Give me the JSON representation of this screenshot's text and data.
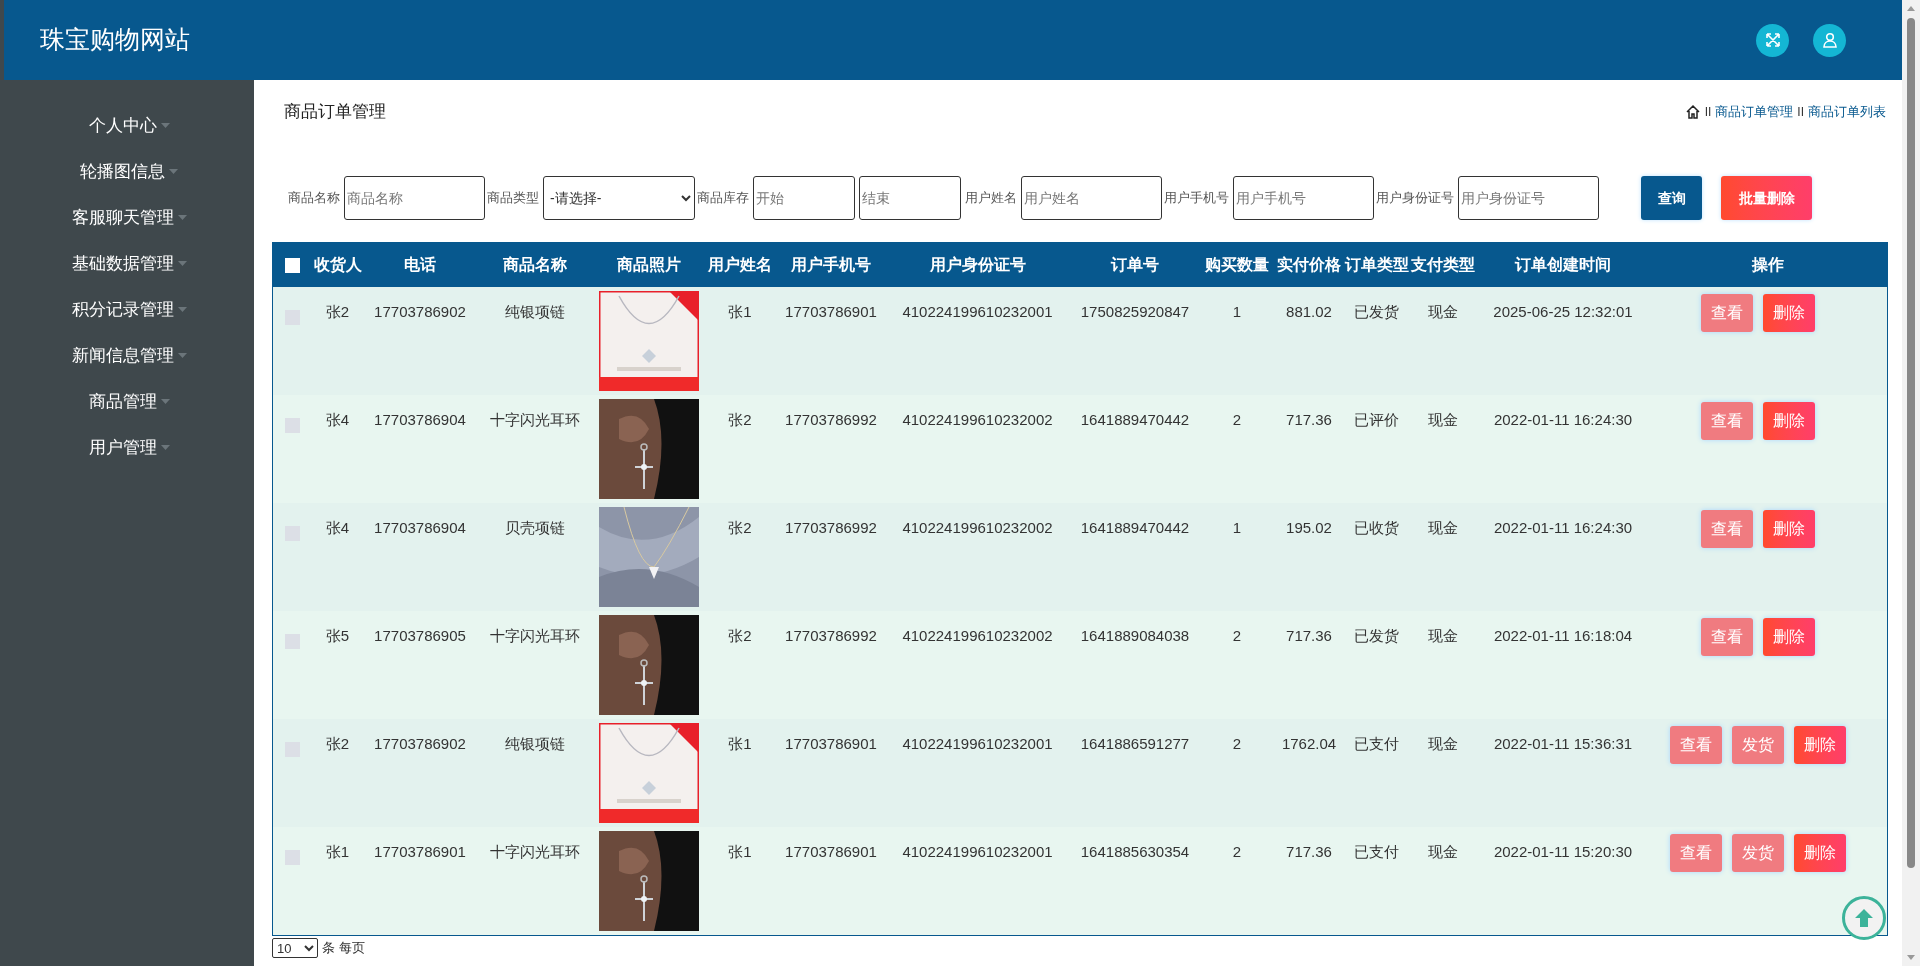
{
  "header": {
    "title": "珠宝购物网站"
  },
  "sidebar": {
    "items": [
      {
        "label": "个人中心"
      },
      {
        "label": "轮播图信息"
      },
      {
        "label": "客服聊天管理"
      },
      {
        "label": "基础数据管理"
      },
      {
        "label": "积分记录管理"
      },
      {
        "label": "新闻信息管理"
      },
      {
        "label": "商品管理"
      },
      {
        "label": "用户管理"
      }
    ]
  },
  "page_title": "商品订单管理",
  "breadcrumb": [
    {
      "kind": "home"
    },
    {
      "kind": "separator",
      "text": "II"
    },
    {
      "kind": "link",
      "text": "商品订单管理"
    },
    {
      "kind": "separator",
      "text": "II"
    },
    {
      "kind": "link",
      "text": "商品订单列表"
    }
  ],
  "search": {
    "fields": [
      {
        "label": "商品名称",
        "inputs": [
          {
            "kind": "text",
            "placeholder": "商品名称"
          }
        ]
      },
      {
        "label": "商品类型",
        "inputs": [
          {
            "kind": "select",
            "value": "-请选择-"
          }
        ]
      },
      {
        "label": "商品库存",
        "inputs": [
          {
            "kind": "short",
            "placeholder": "开始"
          },
          {
            "kind": "short",
            "placeholder": "结束"
          }
        ]
      },
      {
        "label": "用户姓名",
        "inputs": [
          {
            "kind": "text",
            "placeholder": "用户姓名"
          }
        ]
      },
      {
        "label": "用户手机号",
        "inputs": [
          {
            "kind": "text",
            "placeholder": "用户手机号"
          }
        ]
      },
      {
        "label": "用户身份证号",
        "inputs": [
          {
            "kind": "text",
            "placeholder": "用户身份证号"
          }
        ]
      }
    ],
    "buttons": [
      {
        "kind": "query",
        "label": "查询"
      },
      {
        "kind": "bulk_delete",
        "label": "批量删除"
      }
    ]
  },
  "table": {
    "select_all_checked": false,
    "columns": [
      "收货人",
      "电话",
      "商品名称",
      "商品照片",
      "用户姓名",
      "用户手机号",
      "用户身份证号",
      "订单号",
      "购买数量",
      "实付价格",
      "订单类型",
      "支付类型",
      "订单创建时间",
      "操作"
    ],
    "rows": [
      {
        "checked": false,
        "cells": [
          "张2",
          "17703786902",
          "纯银项链",
          {
            "kind": "picture"
          },
          "张1",
          "17703786901",
          "410224199610232001",
          "1750825920847",
          "1",
          "881.02",
          "已发货",
          "现金",
          "2025-06-25 12:32:01"
        ],
        "actions": [
          {
            "kind": "view",
            "label": "查看"
          },
          {
            "kind": "delete",
            "label": "删除"
          }
        ]
      },
      {
        "checked": false,
        "cells": [
          "张4",
          "17703786904",
          "十字闪光耳环",
          {
            "kind": "picture"
          },
          "张2",
          "17703786992",
          "410224199610232002",
          "1641889470442",
          "2",
          "717.36",
          "已评价",
          "现金",
          "2022-01-11 16:24:30"
        ],
        "actions": [
          {
            "kind": "view",
            "label": "查看"
          },
          {
            "kind": "delete",
            "label": "删除"
          }
        ]
      },
      {
        "checked": false,
        "cells": [
          "张4",
          "17703786904",
          "贝壳项链",
          {
            "kind": "picture"
          },
          "张2",
          "17703786992",
          "410224199610232002",
          "1641889470442",
          "1",
          "195.02",
          "已收货",
          "现金",
          "2022-01-11 16:24:30"
        ],
        "actions": [
          {
            "kind": "view",
            "label": "查看"
          },
          {
            "kind": "delete",
            "label": "删除"
          }
        ]
      },
      {
        "checked": false,
        "cells": [
          "张5",
          "17703786905",
          "十字闪光耳环",
          {
            "kind": "picture"
          },
          "张2",
          "17703786992",
          "410224199610232002",
          "1641889084038",
          "2",
          "717.36",
          "已发货",
          "现金",
          "2022-01-11 16:18:04"
        ],
        "actions": [
          {
            "kind": "view",
            "label": "查看"
          },
          {
            "kind": "delete",
            "label": "删除"
          }
        ]
      },
      {
        "checked": false,
        "cells": [
          "张2",
          "17703786902",
          "纯银项链",
          {
            "kind": "picture"
          },
          "张1",
          "17703786901",
          "410224199610232001",
          "1641886591277",
          "2",
          "1762.04",
          "已支付",
          "现金",
          "2022-01-11 15:36:31"
        ],
        "actions": [
          {
            "kind": "view",
            "label": "查看"
          },
          {
            "kind": "ship",
            "label": "发货"
          },
          {
            "kind": "delete",
            "label": "删除"
          }
        ]
      },
      {
        "checked": false,
        "cells": [
          "张1",
          "17703786901",
          "十字闪光耳环",
          {
            "kind": "picture"
          },
          "张1",
          "17703786901",
          "410224199610232001",
          "1641885630354",
          "2",
          "717.36",
          "已支付",
          "现金",
          "2022-01-11 15:20:30"
        ],
        "actions": [
          {
            "kind": "view",
            "label": "查看"
          },
          {
            "kind": "ship",
            "label": "发货"
          },
          {
            "kind": "delete",
            "label": "删除"
          }
        ]
      }
    ]
  },
  "pager": {
    "page_size": "10",
    "text": "条 每页"
  }
}
